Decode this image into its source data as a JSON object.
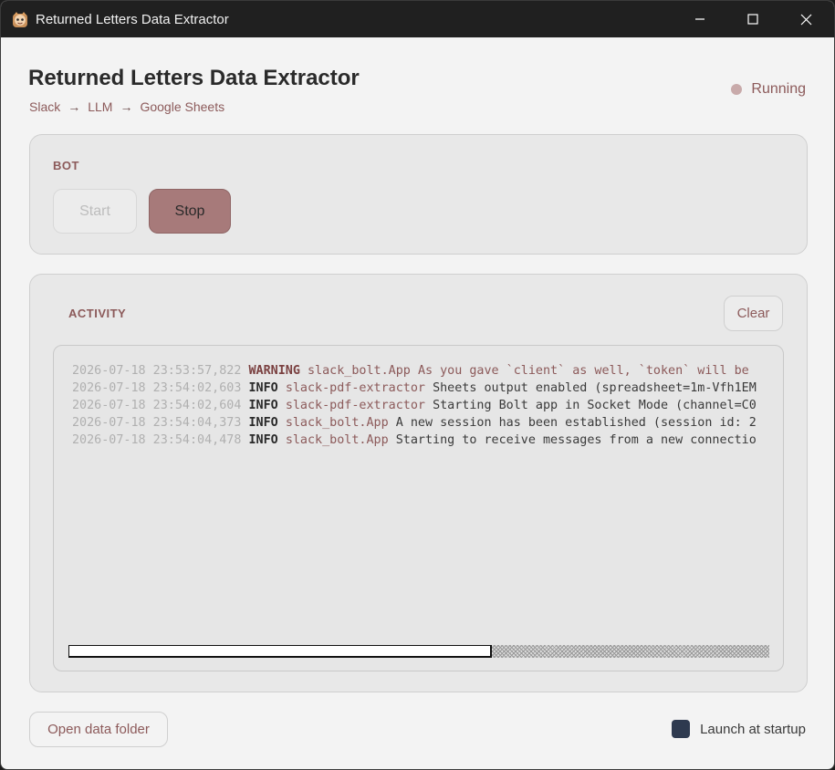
{
  "window": {
    "title": "Returned Letters Data Extractor",
    "app_icon": "bot-mascot-icon",
    "controls": [
      "minimize-icon",
      "maximize-icon",
      "close-icon"
    ]
  },
  "header": {
    "title": "Returned Letters Data Extractor",
    "breadcrumb": [
      "Slack",
      "LLM",
      "Google Sheets"
    ],
    "breadcrumb_separator": "→",
    "status": "Running",
    "status_color": "#c8aaaa"
  },
  "bot": {
    "label": "BOT",
    "start_label": "Start",
    "stop_label": "Stop"
  },
  "activity": {
    "label": "ACTIVITY",
    "clear_label": "Clear",
    "horizontal_scroll_fraction": 0.6,
    "logs": [
      {
        "timestamp": "2026-07-18 23:53:57,822",
        "level": "WARNING",
        "source": "slack_bolt.App",
        "message": "As you gave `client` as well, `token` will be"
      },
      {
        "timestamp": "2026-07-18 23:54:02,603",
        "level": "INFO",
        "source": "slack-pdf-extractor",
        "message": "Sheets output enabled (spreadsheet=1m-Vfh1EM"
      },
      {
        "timestamp": "2026-07-18 23:54:02,604",
        "level": "INFO",
        "source": "slack-pdf-extractor",
        "message": "Starting Bolt app in Socket Mode (channel=C0"
      },
      {
        "timestamp": "2026-07-18 23:54:04,373",
        "level": "INFO",
        "source": "slack_bolt.App",
        "message": "A new session has been established (session id: 2"
      },
      {
        "timestamp": "2026-07-18 23:54:04,478",
        "level": "INFO",
        "source": "slack_bolt.App",
        "message": "Starting to receive messages from a new connectio"
      }
    ]
  },
  "footer": {
    "open_folder_label": "Open data folder",
    "launch_startup_label": "Launch at startup",
    "checkbox_color": "#2e3a4f"
  },
  "colors": {
    "accent": "#a77a7a",
    "text_muted": "#8c5a5a",
    "titlebar": "#202020"
  }
}
